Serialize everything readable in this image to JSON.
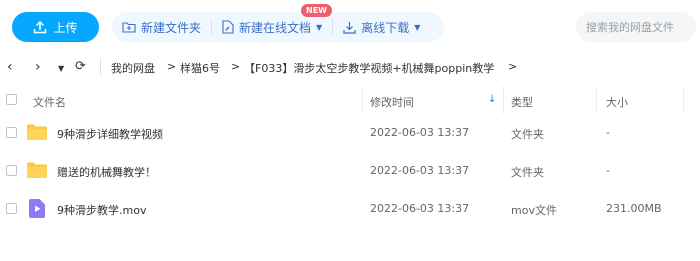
{
  "toolbar": {
    "upload_label": "上传",
    "new_folder_label": "新建文件夹",
    "new_online_doc_label": "新建在线文档",
    "new_badge": "NEW",
    "offline_download_label": "离线下载",
    "search_placeholder": "搜索我的网盘文件"
  },
  "breadcrumb": {
    "items": [
      "我的网盘",
      "样猫6号",
      "【F033】滑步太空步教学视频+机械舞poppin教学"
    ],
    "separator": ">"
  },
  "table": {
    "headers": {
      "name": "文件名",
      "modified": "修改时间",
      "type": "类型",
      "size": "大小"
    },
    "rows": [
      {
        "name": "9种滑步详细教学视频",
        "modified": "2022-06-03 13:37",
        "type": "文件夹",
        "size": "-",
        "icon": "folder-icon"
      },
      {
        "name": "赠送的机械舞教学！",
        "modified": "2022-06-03 13:37",
        "type": "文件夹",
        "size": "-",
        "icon": "folder-icon"
      },
      {
        "name": "9种滑步教学.mov",
        "modified": "2022-06-03 13:37",
        "type": "mov文件",
        "size": "231.00MB",
        "icon": "video-file-icon"
      }
    ]
  },
  "colors": {
    "accent": "#06a7ff",
    "folder": "#ffc93c",
    "video_icon": "#8b7cf6",
    "badge": "#f05e6d"
  }
}
